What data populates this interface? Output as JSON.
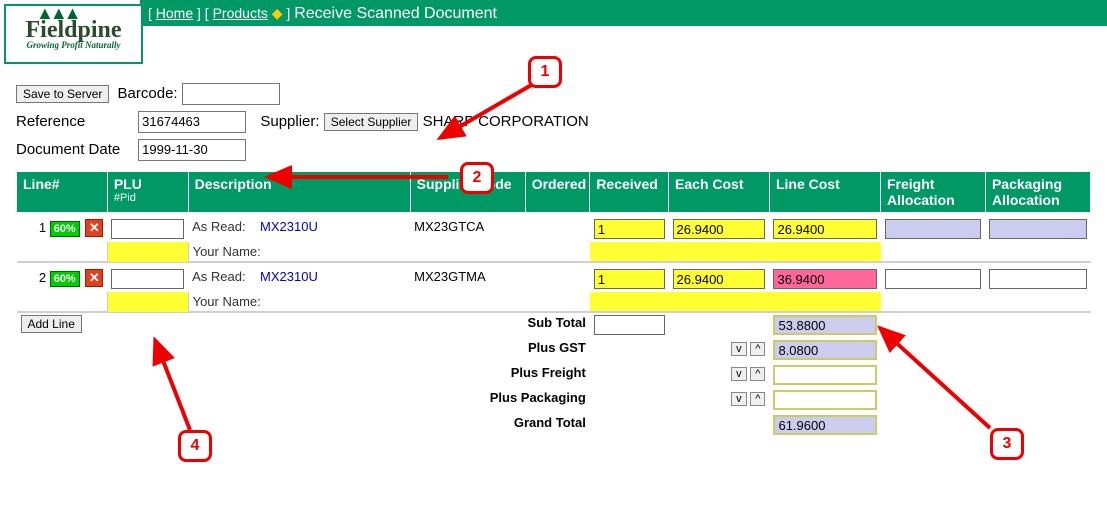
{
  "logo": {
    "name": "Fieldpine",
    "tagline": "Growing Profit Naturally"
  },
  "header": {
    "home": "Home",
    "products": "Products",
    "title": "Receive Scanned Document"
  },
  "form": {
    "save_btn": "Save to Server",
    "barcode_label": "Barcode:",
    "barcode_value": "",
    "reference_label": "Reference",
    "reference_value": "31674463",
    "supplier_label": "Supplier:",
    "select_supplier_btn": "Select Supplier",
    "supplier_name": "SHARP CORPORATION",
    "docdate_label": "Document Date",
    "docdate_value": "1999-11-30"
  },
  "grid": {
    "headers": {
      "line": "Line#",
      "plu": "PLU",
      "plu_sub": "#Pid",
      "desc": "Description",
      "supcode": "Supplier Code",
      "ordered": "Ordered",
      "received": "Received",
      "eachcost": "Each Cost",
      "linecost": "Line Cost",
      "freight": "Freight Allocation",
      "packaging": "Packaging Allocation"
    },
    "as_read_label": "As Read:",
    "your_name_label": "Your Name:",
    "pct_badge": "60%",
    "rows": [
      {
        "line": "1",
        "plu": "",
        "desc_link": "MX2310U",
        "supcode": "MX23GTCA",
        "received": "1",
        "eachcost": "26.9400",
        "linecost": "26.9400",
        "linecost_pink": false
      },
      {
        "line": "2",
        "plu": "",
        "desc_link": "MX2310U",
        "supcode": "MX23GTMA",
        "received": "1",
        "eachcost": "26.9400",
        "linecost": "36.9400",
        "linecost_pink": true
      }
    ],
    "add_line_btn": "Add Line"
  },
  "totals": {
    "subtotal_label": "Sub Total",
    "subtotal_value": "53.8800",
    "gst_label": "Plus GST",
    "gst_value": "8.0800",
    "freight_label": "Plus Freight",
    "freight_value": "",
    "packaging_label": "Plus Packaging",
    "packaging_value": "",
    "grand_label": "Grand Total",
    "grand_value": "61.9600",
    "v_btn": "v",
    "caret_btn": "^"
  },
  "annotations": {
    "n1": "1",
    "n2": "2",
    "n3": "3",
    "n4": "4"
  }
}
